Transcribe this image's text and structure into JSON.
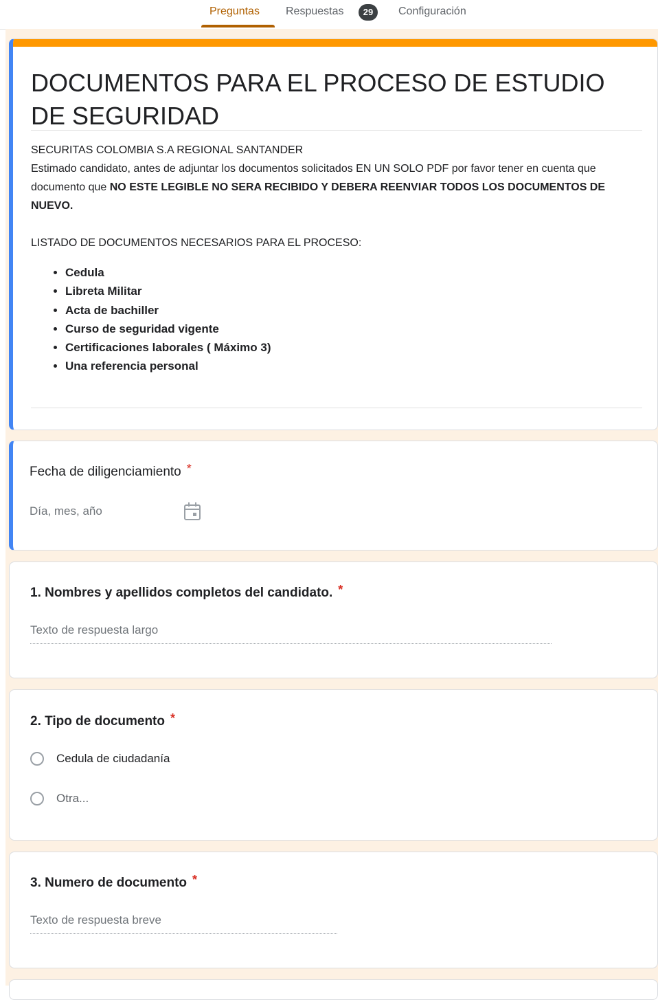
{
  "tabs": {
    "questions": "Preguntas",
    "responses": "Respuestas",
    "responses_count": "29",
    "settings": "Configuración"
  },
  "theme": {
    "header_color": "#ff9800",
    "focus_color": "#4285f4",
    "background": "#fdf1e3"
  },
  "form": {
    "title": "DOCUMENTOS PARA EL PROCESO DE ESTUDIO DE SEGURIDAD",
    "company": "SECURITAS COLOMBIA S.A REGIONAL SANTANDER",
    "notice_normal": "Estimado candidato, antes de adjuntar los documentos solicitados EN UN SOLO PDF por favor tener en cuenta que documento que ",
    "notice_bold": "NO ESTE LEGIBLE NO SERA RECIBIDO Y DEBERA REENVIAR TODOS LOS DOCUMENTOS DE NUEVO.",
    "list_heading": "LISTADO DE DOCUMENTOS NECESARIOS PARA EL PROCESO:",
    "documents": [
      "Cedula",
      "Libreta Militar",
      "Acta de bachiller",
      "Curso de seguridad vigente",
      "Certificaciones laborales ( Máximo 3)",
      "Una referencia personal"
    ]
  },
  "questions": [
    {
      "title": "Fecha de diligenciamiento",
      "required": "*",
      "placeholder": "Día, mes, año",
      "icon": "calendar-icon"
    },
    {
      "title": "1. Nombres y apellidos completos del candidato.",
      "required": "*",
      "placeholder": "Texto de respuesta largo"
    },
    {
      "title": "2. Tipo de documento",
      "required": "*",
      "options": [
        "Cedula de ciudadanía",
        "Otra..."
      ]
    },
    {
      "title": "3. Numero de documento",
      "required": "*",
      "placeholder": "Texto de respuesta breve"
    }
  ]
}
